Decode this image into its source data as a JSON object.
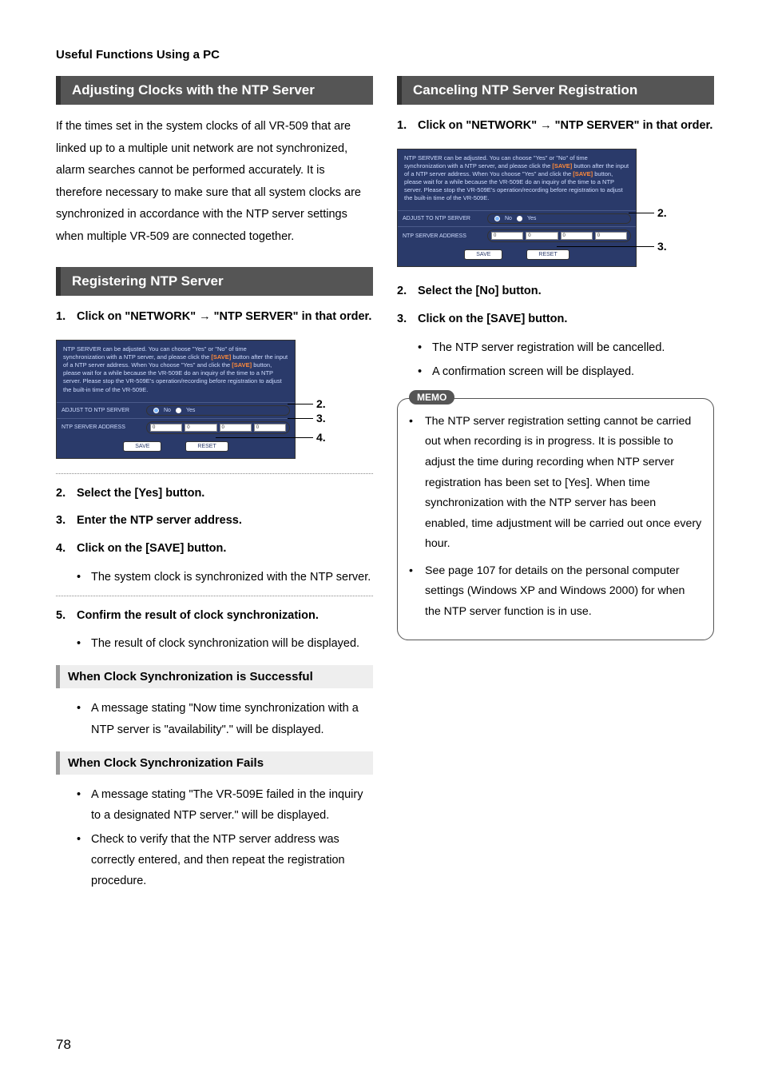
{
  "header": "Useful Functions Using a PC",
  "page_number": "78",
  "left": {
    "banner1": "Adjusting Clocks with the NTP Server",
    "intro": "If the times set in the system clocks of all VR-509 that are linked up to a multiple unit network are not synchronized, alarm searches cannot be performed accurately. It is therefore necessary to make sure that all system clocks are synchronized in accordance with the NTP server settings when multiple VR-509 are connected together.",
    "banner2": "Registering NTP Server",
    "step1_pre": "Click on \"NETWORK\" ",
    "step1_post": " \"NTP SERVER\" in that order.",
    "shot": {
      "desc_a": "NTP SERVER can be adjusted. You can choose \"Yes\" or \"No\" of time synchronization with a NTP server, and please click the ",
      "desc_save": "[SAVE]",
      "desc_b": " button after the input of a NTP server address. When You choose \"Yes\" and click the ",
      "desc_c": " button, please wait for a while because the VR-509E do an inquiry of the time to a NTP server. Please stop the VR-509E's operation/recording before registration to adjust the built-in time of the VR-509E.",
      "row1": "ADJUST TO NTP SERVER",
      "no": "No",
      "yes": "Yes",
      "row2": "NTP SERVER ADDRESS",
      "ipseg": "0",
      "save": "SAVE",
      "reset": "RESET"
    },
    "callout2": "2.",
    "callout3": "3.",
    "callout4": "4.",
    "step2": "Select the [Yes] button.",
    "step3": "Enter the NTP server address.",
    "step4": "Click on the [SAVE] button.",
    "step4_sub": "The system clock is synchronized with the NTP server.",
    "step5": "Confirm the result of clock synchronization.",
    "step5_sub": "The result of clock synchronization will be displayed.",
    "sub_ok": "When Clock Synchronization is Successful",
    "sub_ok_b1": "A message stating \"Now time synchronization with a NTP server is \"availability\".\" will be displayed.",
    "sub_fail": "When Clock Synchronization Fails",
    "sub_fail_b1": "A message stating \"The VR-509E failed in the inquiry to a designated NTP server.\" will be displayed.",
    "sub_fail_b2": "Check to verify that the NTP server address was correctly entered, and then repeat the registration procedure."
  },
  "right": {
    "banner": "Canceling NTP Server Registration",
    "step1_pre": "Click on \"NETWORK\" ",
    "step1_post": " \"NTP SERVER\" in that order.",
    "callout2": "2.",
    "callout3": "3.",
    "step2": "Select the [No] button.",
    "step3": "Click on the [SAVE] button.",
    "step3_sub1": "The NTP server registration will be cancelled.",
    "step3_sub2": "A confirmation screen will be displayed.",
    "memo_label": "MEMO",
    "memo1": "The NTP server registration setting cannot be carried out when recording is in progress. It is possible to adjust the time during recording when NTP server registration has been set to [Yes]. When time synchronization with the NTP server has been enabled, time adjustment will be carried out once every hour.",
    "memo2": "See page 107 for details on the personal computer settings (Windows XP and Windows 2000) for when the NTP server function is in use."
  }
}
